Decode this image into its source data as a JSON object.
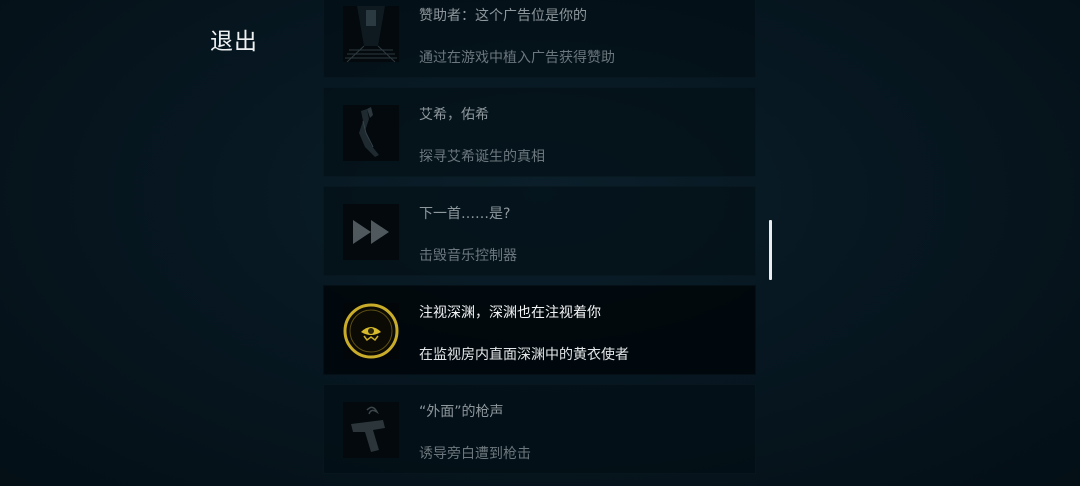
{
  "header": {
    "exit_label": "退出"
  },
  "achievements": [
    {
      "title": "赞助者：这个广告位是你的",
      "description": "通过在游戏中植入广告获得赞助",
      "icon": "corridor-icon",
      "unlocked": false
    },
    {
      "title": "艾希，佑希",
      "description": "探寻艾希诞生的真相",
      "icon": "blade-icon",
      "unlocked": false
    },
    {
      "title": "下一首……是?",
      "description": "击毁音乐控制器",
      "icon": "fast-forward-icon",
      "unlocked": false
    },
    {
      "title": "注视深渊，深渊也在注视着你",
      "description": "在监视房内直面深渊中的黄衣使者",
      "icon": "gold-eye-emblem-icon",
      "unlocked": true
    },
    {
      "title": "“外面”的枪声",
      "description": "诱导旁白遭到枪击",
      "icon": "pistol-icon",
      "unlocked": false
    }
  ],
  "colors": {
    "background": "#071721",
    "card_locked": "#020c12",
    "card_unlocked": "#01080c",
    "emblem_gold": "#c9ad2a"
  }
}
